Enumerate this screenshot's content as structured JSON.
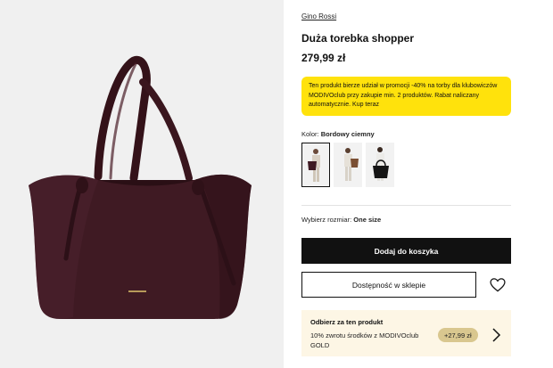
{
  "product": {
    "brand": "Gino Rossi",
    "name": "Duża torebka shopper",
    "price": "279,99 zł",
    "main_image": "burgundy-leather-tote-bag",
    "bag_color": "#3e1b23",
    "gallery_bg": "#f0f0f0"
  },
  "promo": {
    "text": "Ten produkt bierze udział w promocji -40% na torby dla klubowiczów MODIVOclub przy zakupie min. 2 produktów. Rabat naliczany automatycznie. Kup teraz",
    "bg_color": "#ffe20c"
  },
  "color": {
    "label": "Kolor:",
    "value": "Bordowy ciemny",
    "thumbnails": [
      "burgundy-bag-model-thumb",
      "brown-bag-model-thumb",
      "black-bag-model-thumb"
    ]
  },
  "size": {
    "label": "Wybierz rozmiar:",
    "value": "One size"
  },
  "actions": {
    "add_to_cart": "Dodaj do koszyka",
    "availability": "Dostępność w sklepie",
    "wishlist_icon": "heart-icon"
  },
  "reward": {
    "title": "Odbierz za ten produkt",
    "text": "10% zwrotu środków z MODIVOclub GOLD",
    "badge": "+27,99 zł",
    "badge_color": "#d9c78f",
    "bg_color": "#fdf6e5"
  }
}
